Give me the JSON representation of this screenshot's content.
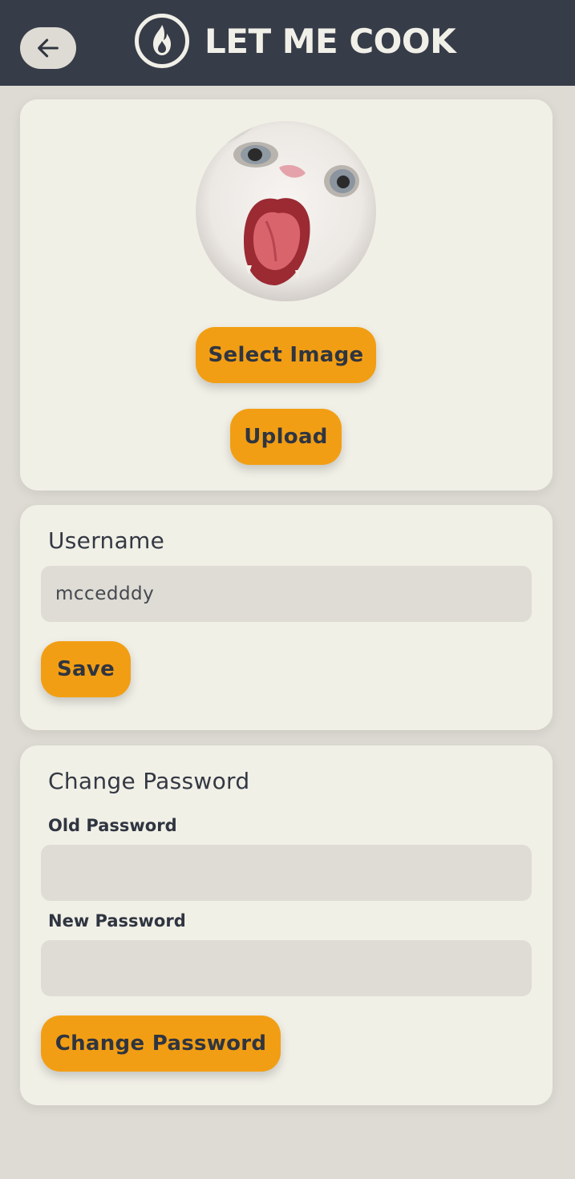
{
  "header": {
    "app_title": "LET ME COOK",
    "back_icon": "arrow-left-icon",
    "logo_icon": "flame-logo-icon",
    "background": "#373c49"
  },
  "avatar_card": {
    "avatar_alt": "profile picture",
    "select_image_label": "Select Image",
    "upload_label": "Upload"
  },
  "username_card": {
    "title": "Username",
    "username_value": "mccedddy",
    "save_label": "Save"
  },
  "password_card": {
    "title": "Change Password",
    "old_password_label": "Old Password",
    "old_password_value": "",
    "new_password_label": "New Password",
    "new_password_value": "",
    "change_password_label": "Change Password"
  },
  "colors": {
    "accent": "#f29e14",
    "card": "#f1f0e7",
    "page": "#dddbd3",
    "input": "#dedcd4",
    "text": "#2f3540"
  }
}
